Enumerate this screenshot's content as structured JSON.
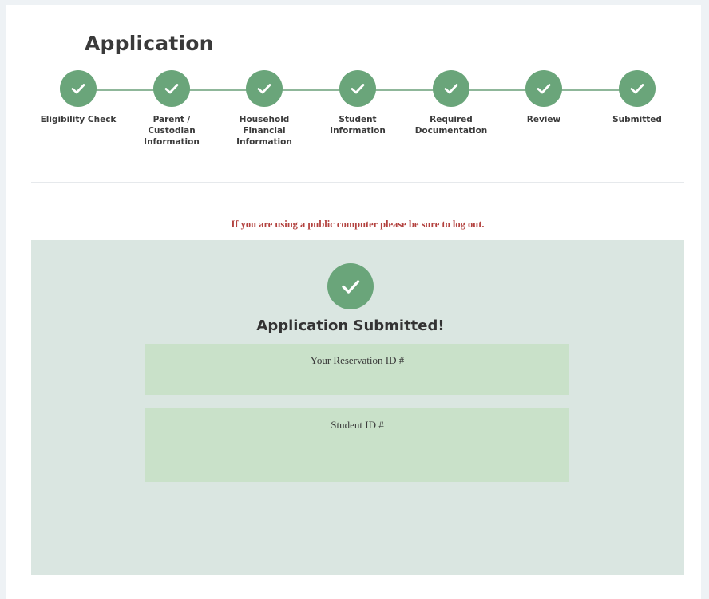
{
  "page": {
    "title": "Application",
    "notice": "If you are using a public computer please be sure to log out."
  },
  "steps": [
    {
      "label": "Eligibility Check",
      "status": "complete",
      "icon": "check-icon"
    },
    {
      "label": "Parent /\nCustodian\nInformation",
      "status": "complete",
      "icon": "check-icon"
    },
    {
      "label": "Household\nFinancial\nInformation",
      "status": "complete",
      "icon": "check-icon"
    },
    {
      "label": "Student\nInformation",
      "status": "complete",
      "icon": "check-icon"
    },
    {
      "label": "Required\nDocumentation",
      "status": "complete",
      "icon": "check-icon"
    },
    {
      "label": "Review",
      "status": "complete",
      "icon": "check-icon"
    },
    {
      "label": "Submitted",
      "status": "complete",
      "icon": "check-icon"
    }
  ],
  "confirmation": {
    "heading": "Application Submitted!",
    "reservation_label": "Your Reservation ID #",
    "reservation_value": "",
    "student_label": "Student ID #",
    "student_value": ""
  },
  "colors": {
    "accent_green": "#6aa57a",
    "notice_red": "#b3423f",
    "panel_bg": "#dae6e1",
    "id_box_bg": "#c9e1c9"
  }
}
